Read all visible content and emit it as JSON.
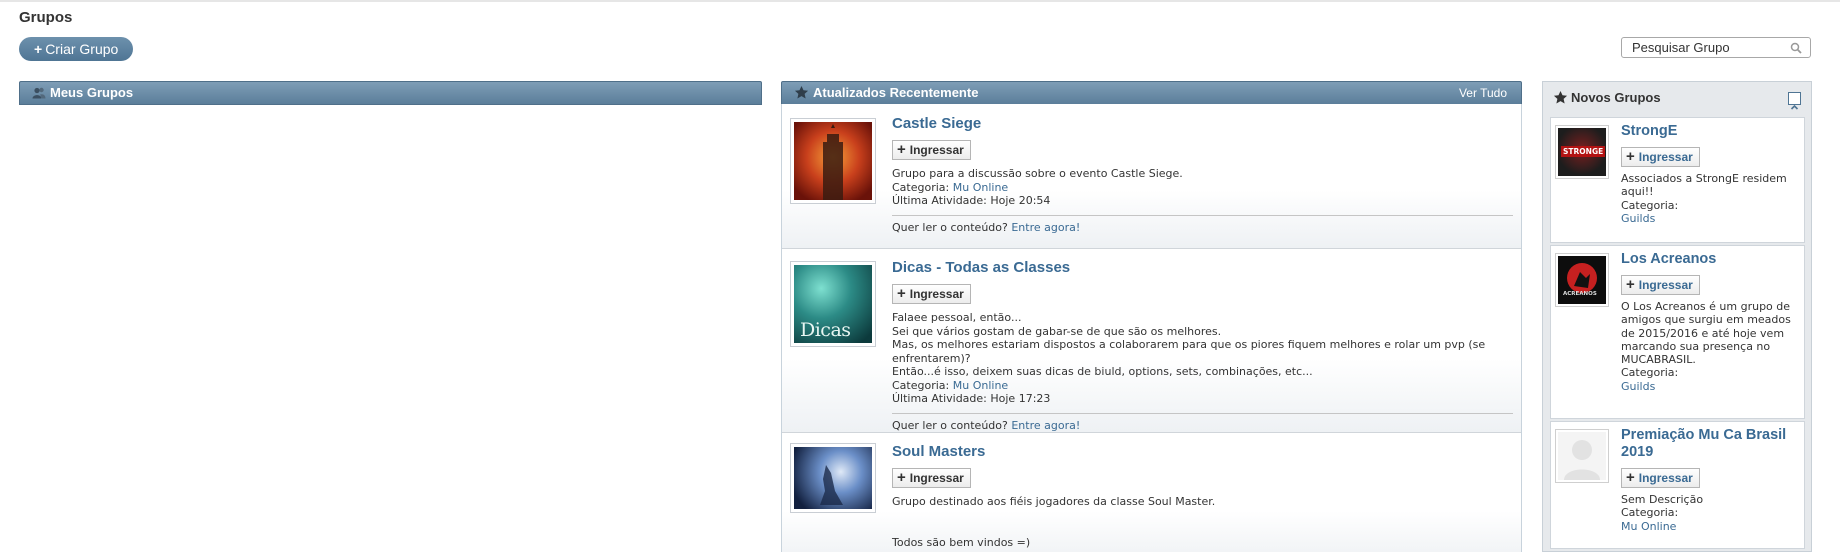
{
  "page": {
    "title": "Grupos"
  },
  "toolbar": {
    "create_label": "Criar Grupo",
    "create_plus": "+"
  },
  "search": {
    "placeholder": "Pesquisar Grupo"
  },
  "my_groups": {
    "header": "Meus Grupos"
  },
  "recent": {
    "header": "Atualizados Recentemente",
    "view_all": "Ver Tudo",
    "join_label": "Ingressar",
    "groups": [
      {
        "title": "Castle Siege",
        "description": [
          "Grupo para a discussão sobre o evento Castle Siege."
        ],
        "category_label": "Categoria:",
        "category": "Mu Online",
        "last_activity": "Última Atividade: Hoje 20:54",
        "cta_text": "Quer ler o conteúdo?",
        "cta_link": "Entre agora!"
      },
      {
        "title": "Dicas - Todas as Classes",
        "description": [
          "Falaee pessoal, então...",
          "Sei que vários gostam de gabar-se de que são os melhores.",
          "Mas, os melhores estariam dispostos a colaborarem para que os piores fiquem melhores e rolar um pvp (se enfrentarem)?",
          "Então...é isso, deixem suas dicas de biuld, options, sets, combinações, etc..."
        ],
        "category_label": "Categoria:",
        "category": "Mu Online",
        "last_activity": "Última Atividade: Hoje 17:23",
        "cta_text": "Quer ler o conteúdo?",
        "cta_link": "Entre agora!"
      },
      {
        "title": "Soul Masters",
        "description": [
          "Grupo destinado aos fiéis jogadores da classe Soul Master.",
          "",
          "",
          "Todos são bem vindos =)"
        ]
      }
    ]
  },
  "new_groups": {
    "header": "Novos Grupos",
    "join_label": "Ingressar",
    "category_label": "Categoria:",
    "groups": [
      {
        "title": "StrongE",
        "description": "Associados a StrongE residem aqui!!",
        "category": "Guilds",
        "logo_text": "STRONGE"
      },
      {
        "title": "Los Acreanos",
        "description": "O Los Acreanos é um grupo de amigos que surgiu em meados de 2015/2016 e até hoje vem marcando sua presença no MUCABRASIL.",
        "category": "Guilds",
        "logo_text": "ACREANOS"
      },
      {
        "title": "Premiação Mu Ca Brasil 2019",
        "description": "Sem Descrição",
        "category": "Mu Online"
      }
    ]
  },
  "colors": {
    "header_blue": "#5b7e9a",
    "link_blue": "#3a6a93",
    "button_blue": "#4f7594"
  }
}
